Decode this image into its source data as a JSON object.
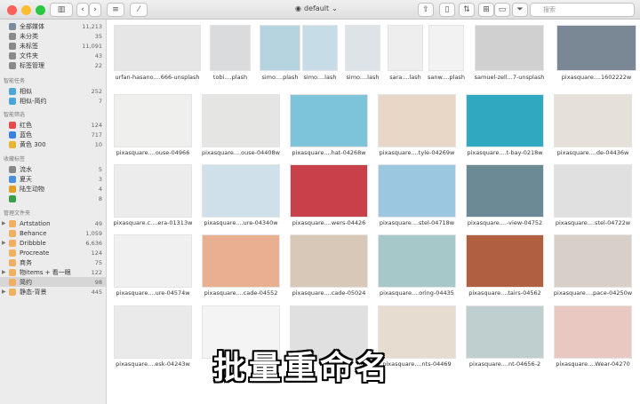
{
  "window": {
    "library": "default",
    "search_placeholder": "搜索"
  },
  "colors": {
    "close": "#fe5f57",
    "minimize": "#febc2e",
    "zoom": "#28c840"
  },
  "sidebar": {
    "library": [
      {
        "label": "全部媒体",
        "count": "11,213",
        "color": "#7a8ca0"
      },
      {
        "label": "未分类",
        "count": "35",
        "color": "#8a8a8a"
      },
      {
        "label": "未标签",
        "count": "11,091",
        "color": "#8a8a8a"
      },
      {
        "label": "文件夹",
        "count": "43",
        "color": "#8a8a8a"
      },
      {
        "label": "标签管理",
        "count": "22",
        "color": "#8a8a8a"
      }
    ],
    "smart_tasks_heading": "智能任务",
    "smart_tasks": [
      {
        "label": "相似",
        "count": "252",
        "color": "#4aa6d8"
      },
      {
        "label": "相似-简约",
        "count": "7",
        "color": "#4aa6d8"
      }
    ],
    "smart_filter_heading": "智能筛选",
    "smart_filters": [
      {
        "label": "红色",
        "count": "124",
        "color": "#e84a4a"
      },
      {
        "label": "蓝色",
        "count": "717",
        "color": "#3b82e0"
      },
      {
        "label": "黄色 300",
        "count": "10",
        "color": "#e8b530"
      }
    ],
    "fav_tags_heading": "收藏标签",
    "fav_tags": [
      {
        "label": "流水",
        "count": "5",
        "color": "#888"
      },
      {
        "label": "夏天",
        "count": "3",
        "color": "#4a90d9"
      },
      {
        "label": "陆生动物",
        "count": "4",
        "color": "#e0a020"
      },
      {
        "label": "",
        "count": "8",
        "color": "#3aa048"
      }
    ],
    "folders_heading": "管理文件夹",
    "folders": [
      {
        "label": "Artstation",
        "count": "49",
        "color": "#f0b060",
        "arrow": "▶"
      },
      {
        "label": "Behance",
        "count": "1,059",
        "color": "#f0b060",
        "arrow": ""
      },
      {
        "label": "Dribbble",
        "count": "6,636",
        "color": "#f0b060",
        "arrow": "▶"
      },
      {
        "label": "Procreate",
        "count": "124",
        "color": "#f0b060",
        "arrow": ""
      },
      {
        "label": "商务",
        "count": "75",
        "color": "#f0b060",
        "arrow": ""
      },
      {
        "label": "物items + 看一眼",
        "count": "122",
        "color": "#f0b060",
        "arrow": "▶"
      },
      {
        "label": "简约",
        "count": "98",
        "color": "#f0b060",
        "arrow": ""
      },
      {
        "label": "静态-背景",
        "count": "445",
        "color": "#f0b060",
        "arrow": "▶"
      }
    ]
  },
  "grid": {
    "captions": [
      "urfan-hasano....666-unsplash",
      "tobi....plash",
      "simo....plash",
      "simo....lash",
      "simo....lash",
      "sara....lash",
      "sanw....plash",
      "samuel-zell...7-unsplash",
      "pixasquare....1602222w",
      "pixasquare....ouse-04966",
      "pixasquare....ouse-04408w",
      "pixasquare....hat-04268w",
      "pixasquare....tyle-04269w",
      "pixasquare....t-bay-0218w",
      "pixasquare....de-04436w",
      "pixasquare.c....era-01313w",
      "pixasquare....ure-04340w",
      "pixasquare....wers-04426",
      "pixasquare....stel-04718w",
      "pixasquare....-view-04752",
      "pixasquare....stel-04722w",
      "pixasquare....ure-04574w",
      "pixasquare....cade-04552",
      "pixasquare....cade-05024",
      "pixasquare....oring-04435",
      "pixasquare....tairs-04562",
      "pixasquare....pace-04250w",
      "pixasquare....esk-04243w",
      "",
      "",
      "pixasquare....nts-04469",
      "pixasquare....nt-04656-2",
      "pixasquare....Wear-04270"
    ]
  },
  "overlay": {
    "text": "批量重命名"
  }
}
